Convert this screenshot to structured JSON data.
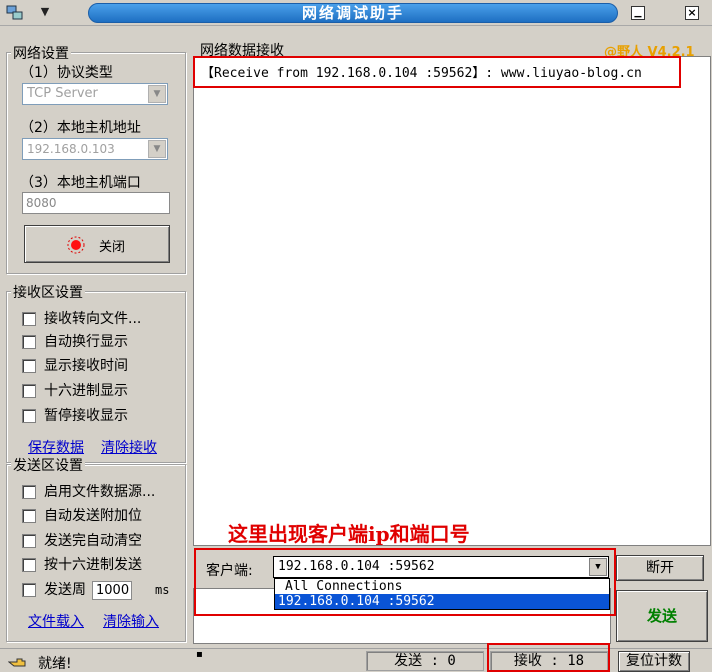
{
  "window": {
    "title": "网络调试助手",
    "version": "@野人 V4.2.1"
  },
  "network_settings": {
    "title": "网络设置",
    "protocol_label": "（1）协议类型",
    "protocol_value": "TCP Server",
    "host_label": "（2）本地主机地址",
    "host_value": "192.168.0.103",
    "port_label": "（3）本地主机端口",
    "port_value": "8080",
    "close_button": "关闭"
  },
  "receive_settings": {
    "title": "接收区设置",
    "options": [
      "接收转向文件...",
      "自动换行显示",
      "显示接收时间",
      "十六进制显示",
      "暂停接收显示"
    ],
    "save_link": "保存数据",
    "clear_link": "清除接收"
  },
  "send_settings": {
    "title": "发送区设置",
    "options": [
      "启用文件数据源...",
      "自动发送附加位",
      "发送完自动清空",
      "按十六进制发送"
    ],
    "cycle_label": "发送周",
    "cycle_value": "1000",
    "cycle_unit": "ms",
    "load_link": "文件载入",
    "clear_link": "清除输入"
  },
  "receive_area": {
    "title": "网络数据接收",
    "text": "【Receive from 192.168.0.104 :59562】: www.liuyao-blog.cn"
  },
  "annotation": "这里出现客户端ip和端口号",
  "client": {
    "label": "客户端:",
    "selected": "192.168.0.104 :59562",
    "options": [
      "All Connections",
      "192.168.0.104 :59562"
    ],
    "disconnect_button": "断开",
    "send_button": "发送"
  },
  "status": {
    "ready": "就绪!",
    "sent": "发送 : 0",
    "received": "接收 : 18",
    "reset_button": "复位计数"
  },
  "colors": {
    "accent": "#1e6fc2",
    "highlight": "#e00000",
    "send_text": "#008000",
    "version": "#e8a000"
  }
}
